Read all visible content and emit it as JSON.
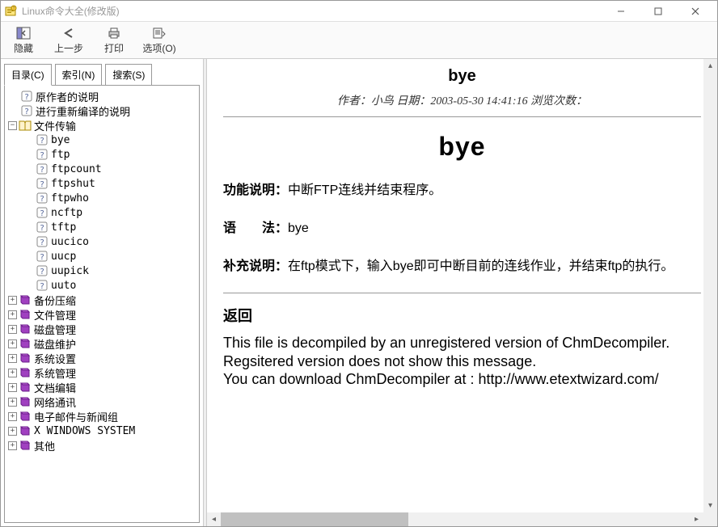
{
  "window": {
    "title": "Linux命令大全(修改版)"
  },
  "toolbar": {
    "hide": "隐藏",
    "back": "上一步",
    "print": "打印",
    "options": "选项(O)"
  },
  "tabs": {
    "contents": "目录(C)",
    "index": "索引(N)",
    "search": "搜索(S)"
  },
  "tree": {
    "root_1": "原作者的说明",
    "root_2": "进行重新编译的说明",
    "folder_file_transfer": "文件传输",
    "ft_items": [
      "bye",
      "ftp",
      "ftpcount",
      "ftpshut",
      "ftpwho",
      "ncftp",
      "tftp",
      "uucico",
      "uucp",
      "uupick",
      "uuto"
    ],
    "folders_collapsed": [
      "备份压缩",
      "文件管理",
      "磁盘管理",
      "磁盘维护",
      "系统设置",
      "系统管理",
      "文档编辑",
      "网络通讯",
      "电子邮件与新闻组",
      "X WINDOWS SYSTEM",
      "其他"
    ]
  },
  "content": {
    "title_small": "bye",
    "meta_author_label": "作者：",
    "meta_author": "小鸟",
    "meta_date_label": "日期：",
    "meta_date": "2003-05-30 14:41:16",
    "meta_views_label": "浏览次数：",
    "title_big": "bye",
    "func_label": "功能说明：",
    "func_text": "中断FTP连线并结束程序。",
    "syntax_label": "语　　法：",
    "syntax_text": "bye",
    "suppl_label": "补充说明：",
    "suppl_text": "在ftp模式下，输入bye即可中断目前的连线作业，并结束ftp的执行。",
    "return": "返回",
    "footer_l1": "This file is decompiled by an unregistered version of ChmDecompiler.",
    "footer_l2": "Regsitered version does not show this message.",
    "footer_l3": "You can download ChmDecompiler at : http://www.etextwizard.com/"
  }
}
